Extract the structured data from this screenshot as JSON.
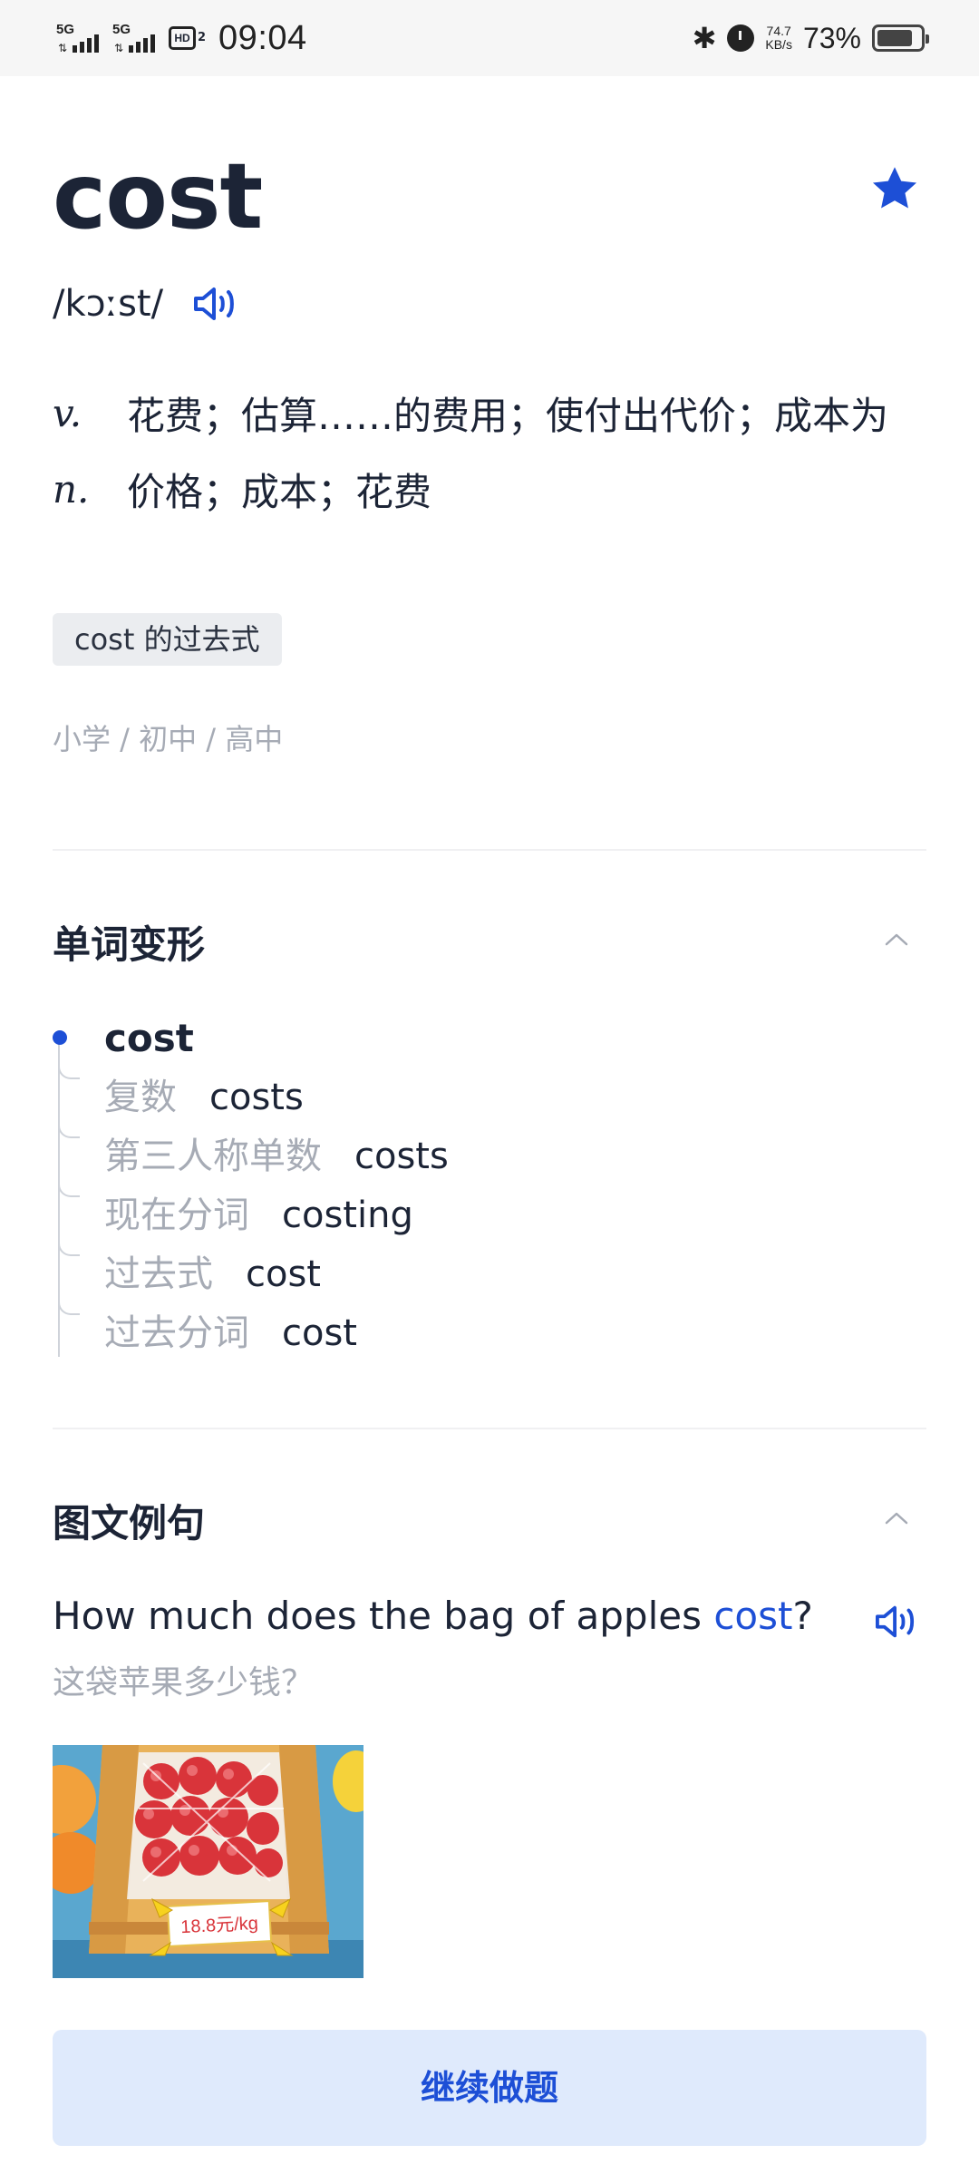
{
  "status_bar": {
    "signal1": "5G",
    "signal2": "5G",
    "hd": "HD",
    "hd_sub": "2",
    "time": "09:04",
    "net_speed_value": "74.7",
    "net_speed_unit": "KB/s",
    "battery": "73%",
    "battery_level": 0.73
  },
  "word": {
    "headword": "cost",
    "phonetic": "/kɔːst/",
    "favorited": true,
    "definitions": [
      {
        "pos": "v.",
        "meaning": "花费；估算……的费用；使付出代价；成本为"
      },
      {
        "pos": "n.",
        "meaning": "价格；成本；花费"
      }
    ],
    "tag": "cost 的过去式",
    "levels": "小学 / 初中 / 高中"
  },
  "forms_section": {
    "title": "单词变形",
    "base": "cost",
    "forms": [
      {
        "label": "复数",
        "value": "costs"
      },
      {
        "label": "第三人称单数",
        "value": "costs"
      },
      {
        "label": "现在分词",
        "value": "costing"
      },
      {
        "label": "过去式",
        "value": "cost"
      },
      {
        "label": "过去分词",
        "value": "cost"
      }
    ]
  },
  "example_section": {
    "title": "图文例句",
    "sentence_before": "How much does the bag of apples ",
    "sentence_highlight": "cost",
    "sentence_after": "?",
    "translation": "这袋苹果多少钱？",
    "image_price_label": "18.8元/kg"
  },
  "cta": {
    "label": "继续做题"
  },
  "colors": {
    "accent": "#1d4fd6",
    "cta_bg": "#dfeafc",
    "muted_text": "#a6abb5",
    "primary_text": "#1c2436"
  }
}
